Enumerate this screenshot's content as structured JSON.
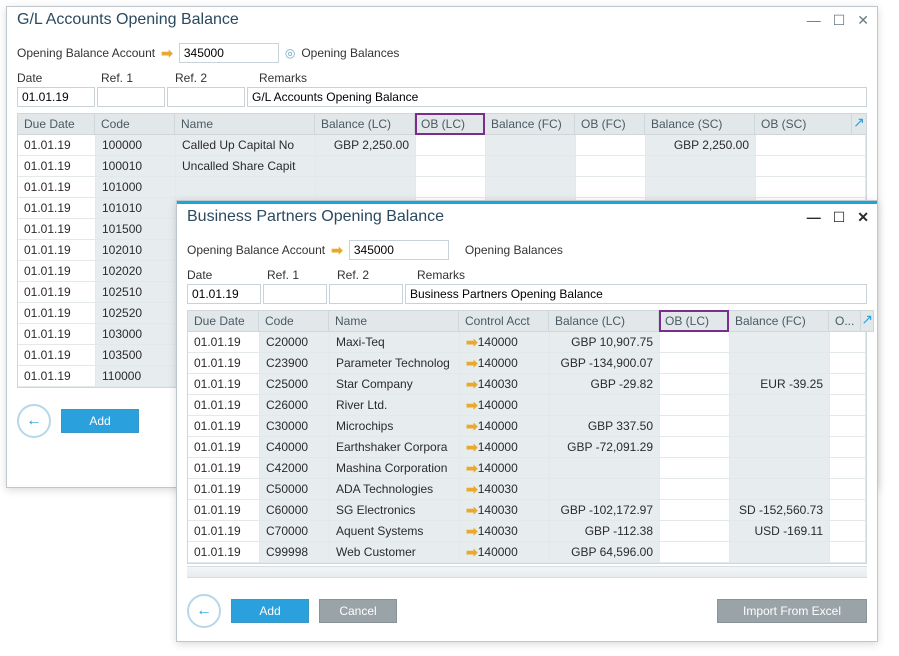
{
  "win1": {
    "title": "G/L Accounts Opening Balance",
    "openbal_label": "Opening Balance Account",
    "openbal_val": "345000",
    "openbal_desc": "Opening Balances",
    "fields": {
      "date_l": "Date",
      "ref1_l": "Ref. 1",
      "ref2_l": "Ref. 2",
      "remarks_l": "Remarks",
      "date": "01.01.19",
      "ref1": "",
      "ref2": "",
      "remarks": "G/L Accounts Opening Balance"
    },
    "headers": [
      "Due Date",
      "Code",
      "Name",
      "Balance (LC)",
      "OB (LC)",
      "Balance (FC)",
      "OB (FC)",
      "Balance (SC)",
      "OB (SC)"
    ],
    "rows": [
      {
        "due": "01.01.19",
        "code": "100000",
        "name": "Called Up Capital No",
        "blc": "GBP 2,250.00",
        "bsc": "GBP 2,250.00"
      },
      {
        "due": "01.01.19",
        "code": "100010",
        "name": "Uncalled Share Capit",
        "blc": "",
        "bsc": ""
      },
      {
        "due": "01.01.19",
        "code": "101000"
      },
      {
        "due": "01.01.19",
        "code": "101010"
      },
      {
        "due": "01.01.19",
        "code": "101500"
      },
      {
        "due": "01.01.19",
        "code": "102010"
      },
      {
        "due": "01.01.19",
        "code": "102020"
      },
      {
        "due": "01.01.19",
        "code": "102510"
      },
      {
        "due": "01.01.19",
        "code": "102520"
      },
      {
        "due": "01.01.19",
        "code": "103000"
      },
      {
        "due": "01.01.19",
        "code": "103500"
      },
      {
        "due": "01.01.19",
        "code": "110000"
      }
    ],
    "add": "Add"
  },
  "win2": {
    "title": "Business Partners Opening Balance",
    "openbal_label": "Opening Balance Account",
    "openbal_val": "345000",
    "openbal_desc": "Opening Balances",
    "fields": {
      "date_l": "Date",
      "ref1_l": "Ref. 1",
      "ref2_l": "Ref. 2",
      "remarks_l": "Remarks",
      "date": "01.01.19",
      "ref1": "",
      "ref2": "",
      "remarks": "Business Partners Opening Balance"
    },
    "headers": [
      "Due Date",
      "Code",
      "Name",
      "Control Acct",
      "Balance (LC)",
      "OB (LC)",
      "Balance (FC)",
      "O..."
    ],
    "rows": [
      {
        "due": "01.01.19",
        "code": "C20000",
        "name": "Maxi-Teq",
        "ctrl": "140000",
        "blc": "GBP 10,907.75",
        "bfc": ""
      },
      {
        "due": "01.01.19",
        "code": "C23900",
        "name": "Parameter Technolog",
        "ctrl": "140000",
        "blc": "GBP -134,900.07",
        "bfc": ""
      },
      {
        "due": "01.01.19",
        "code": "C25000",
        "name": "Star Company",
        "ctrl": "140030",
        "blc": "GBP -29.82",
        "bfc": "EUR -39.25"
      },
      {
        "due": "01.01.19",
        "code": "C26000",
        "name": "River Ltd.",
        "ctrl": "140000",
        "blc": "",
        "bfc": ""
      },
      {
        "due": "01.01.19",
        "code": "C30000",
        "name": "Microchips",
        "ctrl": "140000",
        "blc": "GBP 337.50",
        "bfc": ""
      },
      {
        "due": "01.01.19",
        "code": "C40000",
        "name": "Earthshaker Corpora",
        "ctrl": "140000",
        "blc": "GBP -72,091.29",
        "bfc": ""
      },
      {
        "due": "01.01.19",
        "code": "C42000",
        "name": "Mashina Corporation",
        "ctrl": "140000",
        "blc": "",
        "bfc": ""
      },
      {
        "due": "01.01.19",
        "code": "C50000",
        "name": "ADA Technologies",
        "ctrl": "140030",
        "blc": "",
        "bfc": ""
      },
      {
        "due": "01.01.19",
        "code": "C60000",
        "name": "SG Electronics",
        "ctrl": "140030",
        "blc": "GBP -102,172.97",
        "bfc": "SD -152,560.73"
      },
      {
        "due": "01.01.19",
        "code": "C70000",
        "name": "Aquent Systems",
        "ctrl": "140030",
        "blc": "GBP -112.38",
        "bfc": "USD -169.11"
      },
      {
        "due": "01.01.19",
        "code": "C99998",
        "name": "Web Customer",
        "ctrl": "140000",
        "blc": "GBP 64,596.00",
        "bfc": ""
      }
    ],
    "add": "Add",
    "cancel": "Cancel",
    "import": "Import From Excel"
  }
}
